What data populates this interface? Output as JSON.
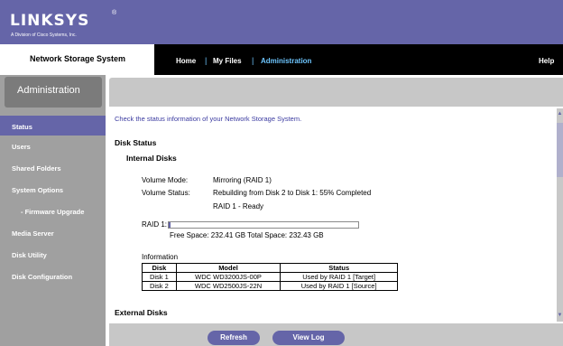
{
  "brand": {
    "logo": "LINKSYS",
    "trademark": "®",
    "tagline": "A Division of Cisco Systems, Inc."
  },
  "topbar": {
    "system_name": "Network Storage System",
    "nav": [
      "Home",
      "My Files",
      "Administration"
    ],
    "separator": "|",
    "help": "Help"
  },
  "sidebar": {
    "title": "Administration",
    "items": [
      "Status",
      "Users",
      "Shared Folders",
      "System Options",
      "- Firmware Upgrade",
      "Media Server",
      "Disk Utility",
      "Disk Configuration"
    ],
    "active_index": 0
  },
  "main": {
    "intro": "Check the status information of your Network Storage System.",
    "disk_status_title": "Disk Status",
    "internal_title": "Internal Disks",
    "volume_mode_label": "Volume Mode:",
    "volume_mode_value": "Mirroring (RAID 1)",
    "volume_status_label": "Volume Status:",
    "volume_status_line1": "Rebuilding from Disk 2 to Disk 1: 55% Completed",
    "volume_status_line2": "RAID 1 - Ready",
    "raid_label": "RAID 1:",
    "raid_fill_fraction": 0.01,
    "space_text": "Free Space: 232.41 GB   Total Space: 232.43 GB",
    "information_label": "Information",
    "table": {
      "headers": [
        "Disk",
        "Model",
        "Status"
      ],
      "rows": [
        [
          "Disk 1",
          "WDC WD3200JS-00P",
          "Used by RAID 1 [Target]"
        ],
        [
          "Disk 2",
          "WDC WD2500JS-22N",
          "Used by RAID 1 [Source]"
        ]
      ]
    },
    "external_title": "External Disks"
  },
  "buttons": {
    "refresh": "Refresh",
    "view_log": "View Log"
  },
  "colors": {
    "brand_purple": "#6565a8",
    "nav_active": "#6ec6ff",
    "sidebar_gray": "#a0a0a0",
    "intro_text": "#3b3ba0"
  }
}
